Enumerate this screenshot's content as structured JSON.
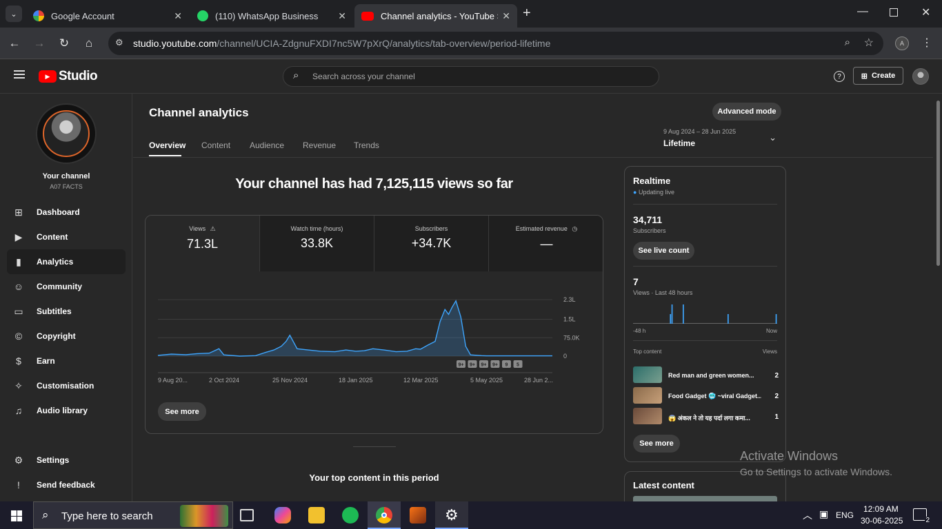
{
  "browser": {
    "tabs": [
      {
        "label": "Google Account",
        "active": false
      },
      {
        "label": "(110) WhatsApp Business",
        "active": false
      },
      {
        "label": "Channel analytics - YouTube Stu",
        "active": true
      }
    ],
    "url_host": "studio.youtube.com",
    "url_path": "/channel/UCIA-ZdgnuFXDI7nc5W7pXrQ/analytics/tab-overview/period-lifetime"
  },
  "studio": {
    "logo": "Studio",
    "search_placeholder": "Search across your channel",
    "create_label": "Create"
  },
  "sidebar": {
    "channel_title": "Your channel",
    "channel_name": "A07 FACTS",
    "items": [
      {
        "label": "Dashboard",
        "icon": "grid-icon"
      },
      {
        "label": "Content",
        "icon": "play-icon"
      },
      {
        "label": "Analytics",
        "icon": "bar-chart-icon",
        "active": true
      },
      {
        "label": "Community",
        "icon": "community-icon"
      },
      {
        "label": "Subtitles",
        "icon": "subtitles-icon"
      },
      {
        "label": "Copyright",
        "icon": "copyright-icon"
      },
      {
        "label": "Earn",
        "icon": "dollar-icon"
      },
      {
        "label": "Customisation",
        "icon": "wand-icon"
      },
      {
        "label": "Audio library",
        "icon": "audio-icon"
      }
    ],
    "settings": "Settings",
    "feedback": "Send feedback"
  },
  "analytics": {
    "title": "Channel analytics",
    "advanced_mode": "Advanced mode",
    "tabs": [
      "Overview",
      "Content",
      "Audience",
      "Revenue",
      "Trends"
    ],
    "period_range": "9 Aug 2024 – 28 Jun 2025",
    "period_label": "Lifetime",
    "headline": "Your channel has had 7,125,115 views so far",
    "metrics": [
      {
        "label": "Views",
        "value": "71.3L"
      },
      {
        "label": "Watch time (hours)",
        "value": "33.8K"
      },
      {
        "label": "Subscribers",
        "value": "+34.7K"
      },
      {
        "label": "Estimated revenue",
        "value": "—"
      }
    ],
    "see_more": "See more",
    "top_content_heading": "Your top content in this period",
    "markers": [
      "9+",
      "9+",
      "9+",
      "9+",
      "9",
      "5"
    ]
  },
  "chart_data": {
    "type": "area",
    "series_name": "Views",
    "x_tick_labels": [
      "9 Aug 20...",
      "2 Oct 2024",
      "25 Nov 2024",
      "18 Jan 2025",
      "12 Mar 2025",
      "5 May 2025",
      "28 Jun 2..."
    ],
    "y_tick_labels": [
      "2.3L",
      "1.5L",
      "75.0K",
      "0"
    ],
    "ylim": [
      0,
      230000
    ],
    "grid": true,
    "x_dates": [
      "2024-08-09",
      "2024-08-20",
      "2024-09-01",
      "2024-09-10",
      "2024-09-20",
      "2024-09-28",
      "2024-10-02",
      "2024-10-15",
      "2024-10-28",
      "2024-11-05",
      "2024-11-12",
      "2024-11-18",
      "2024-11-22",
      "2024-11-25",
      "2024-12-01",
      "2024-12-10",
      "2024-12-20",
      "2025-01-01",
      "2025-01-10",
      "2025-01-18",
      "2025-01-25",
      "2025-02-01",
      "2025-02-10",
      "2025-02-20",
      "2025-03-01",
      "2025-03-08",
      "2025-03-12",
      "2025-03-18",
      "2025-03-24",
      "2025-03-28",
      "2025-04-01",
      "2025-04-04",
      "2025-04-07",
      "2025-04-10",
      "2025-04-14",
      "2025-04-18",
      "2025-04-22",
      "2025-05-01",
      "2025-05-05",
      "2025-05-20",
      "2025-06-10",
      "2025-06-28"
    ],
    "values": [
      3000,
      8000,
      6000,
      10000,
      12000,
      30000,
      5000,
      0,
      2000,
      15000,
      25000,
      40000,
      60000,
      85000,
      30000,
      25000,
      20000,
      18000,
      25000,
      20000,
      22000,
      30000,
      25000,
      18000,
      20000,
      30000,
      28000,
      45000,
      60000,
      140000,
      190000,
      170000,
      200000,
      225000,
      160000,
      40000,
      5000,
      2000,
      1000,
      1000,
      1000,
      1000
    ]
  },
  "realtime": {
    "title": "Realtime",
    "status": "Updating live",
    "subscribers_value": "34,711",
    "subscribers_label": "Subscribers",
    "see_live_count": "See live count",
    "views_value": "7",
    "views_label": "Views · Last 48 hours",
    "axis_start": "-48 h",
    "axis_end": "Now",
    "bars": [
      0,
      0,
      0,
      0,
      0,
      0,
      0,
      0,
      0,
      0,
      0,
      0,
      0,
      0,
      0,
      0,
      0,
      0,
      0,
      0,
      0,
      0,
      0,
      1,
      2,
      0,
      0,
      0,
      0,
      0,
      0,
      2,
      0,
      0,
      0,
      0,
      0,
      0,
      0,
      0,
      0,
      0,
      0,
      0,
      0,
      0,
      0,
      0,
      0,
      0,
      0,
      0,
      0,
      0,
      0,
      0,
      0,
      0,
      0,
      1,
      0,
      0,
      0,
      0,
      0,
      0,
      0,
      0,
      0,
      0,
      0,
      0,
      0,
      0,
      0,
      0,
      0,
      0,
      0,
      0,
      0,
      0,
      0,
      0,
      0,
      0,
      0,
      0,
      0,
      1
    ],
    "top_content_label": "Top content",
    "top_views_label": "Views",
    "top_content": [
      {
        "title": "Red man and green women...",
        "views": "2"
      },
      {
        "title": "Food Gadget 🥶 ~viral Gadget...",
        "views": "2"
      },
      {
        "title": "😱 अंकल ने तो यह पर्दा लगा कमा...",
        "views": "1"
      }
    ],
    "see_more": "See more",
    "latest_content": "Latest content"
  },
  "overlay": {
    "activate_title": "Activate Windows",
    "activate_sub": "Go to Settings to activate Windows."
  },
  "taskbar": {
    "search_placeholder": "Type here to search",
    "lang": "ENG",
    "time": "12:09 AM",
    "date": "30-06-2025",
    "notifications": "2"
  }
}
